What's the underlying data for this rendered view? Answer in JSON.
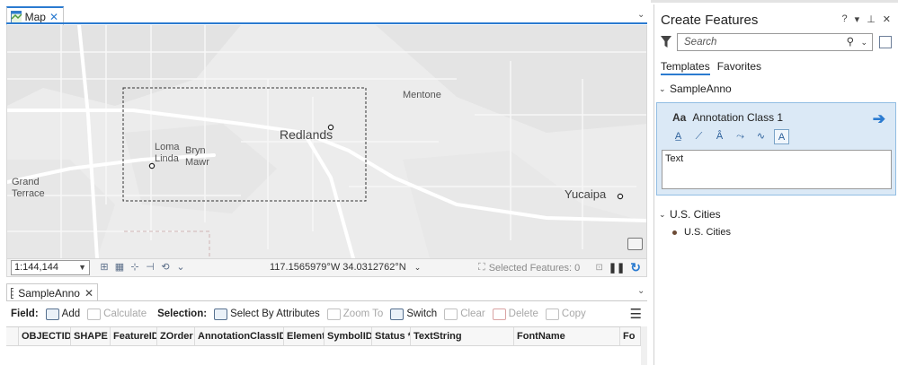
{
  "map_tab": {
    "label": "Map",
    "close": "✕"
  },
  "map_labels": {
    "loma_linda": "Loma\nLinda",
    "bryn_mawr": "Bryn\nMawr",
    "redlands": "Redlands",
    "mentone": "Mentone",
    "grand_terrace": "Grand\nTerrace",
    "yucaipa": "Yucaipa"
  },
  "status_bar": {
    "scale": "1:144,144",
    "coordinates": "117.1565979°W 34.0312762°N",
    "selected_features": "Selected Features: 0"
  },
  "table_tab": {
    "label": "SampleAnno",
    "close": "✕"
  },
  "table_toolbar": {
    "field_label": "Field:",
    "add": "Add",
    "calculate": "Calculate",
    "selection_label": "Selection:",
    "select_by_attributes": "Select By Attributes",
    "zoom_to": "Zoom To",
    "switch": "Switch",
    "clear": "Clear",
    "delete": "Delete",
    "copy": "Copy"
  },
  "table_columns": [
    "OBJECTID *",
    "SHAPE *",
    "FeatureID",
    "ZOrder",
    "AnnotationClassID *",
    "Element",
    "SymbolID",
    "Status *",
    "TextString",
    "FontName",
    "Fo"
  ],
  "panel": {
    "title": "Create Features",
    "controls": {
      "help": "?",
      "menu": "▾",
      "pin": "⊥",
      "close": "✕"
    },
    "search_placeholder": "Search",
    "tabs": {
      "templates": "Templates",
      "favorites": "Favorites"
    },
    "group1": "SampleAnno",
    "template_name": "Annotation Class 1",
    "template_icon": "Aa",
    "text_value": "Text",
    "group2": "U.S. Cities",
    "item2": "U.S. Cities"
  },
  "colors": {
    "accent": "#2b7bd0",
    "selected_card": "#dbe9f6",
    "city_point": "#6b4a35"
  }
}
